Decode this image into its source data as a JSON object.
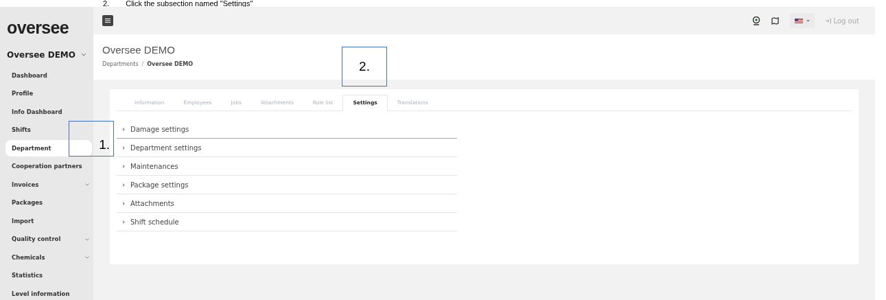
{
  "caption": {
    "number": "2.",
    "text": "Click the subsection named \"Settings\""
  },
  "sidebar": {
    "logo": "oversee",
    "company": "Oversee DEMO",
    "items": [
      {
        "label": "Dashboard",
        "selected": false,
        "has_submenu": false
      },
      {
        "label": "Profile",
        "selected": false,
        "has_submenu": false
      },
      {
        "label": "Info Dashboard",
        "selected": false,
        "has_submenu": false
      },
      {
        "label": "Shifts",
        "selected": false,
        "has_submenu": false
      },
      {
        "label": "Department",
        "selected": true,
        "has_submenu": false
      },
      {
        "label": "Cooperation partners",
        "selected": false,
        "has_submenu": false
      },
      {
        "label": "Invoices",
        "selected": false,
        "has_submenu": true
      },
      {
        "label": "Packages",
        "selected": false,
        "has_submenu": false
      },
      {
        "label": "Import",
        "selected": false,
        "has_submenu": false
      },
      {
        "label": "Quality control",
        "selected": false,
        "has_submenu": true
      },
      {
        "label": "Chemicals",
        "selected": false,
        "has_submenu": true
      },
      {
        "label": "Statistics",
        "selected": false,
        "has_submenu": false
      },
      {
        "label": "Level information",
        "selected": false,
        "has_submenu": false
      }
    ]
  },
  "topbar": {
    "logout": "Log out"
  },
  "header": {
    "title": "Oversee DEMO",
    "breadcrumb": [
      "Departments",
      "Oversee DEMO"
    ],
    "breadcrumb_separator": "/"
  },
  "tabs": [
    {
      "label": "Information",
      "selected": false
    },
    {
      "label": "Employees",
      "selected": false
    },
    {
      "label": "Jobs",
      "selected": false
    },
    {
      "label": "Attachments",
      "selected": false
    },
    {
      "label": "Role list",
      "selected": false
    },
    {
      "label": "Settings",
      "selected": true
    },
    {
      "label": "Translations",
      "selected": false
    }
  ],
  "sections": [
    {
      "label": "Damage settings",
      "expanded": false
    },
    {
      "label": "Department settings",
      "expanded": false
    },
    {
      "label": "Maintenances",
      "expanded": false
    },
    {
      "label": "Package settings",
      "expanded": false
    },
    {
      "label": "Attachments",
      "expanded": false
    },
    {
      "label": "Shift schedule",
      "expanded": false
    }
  ],
  "callouts": [
    {
      "label": "1."
    },
    {
      "label": "2."
    }
  ]
}
